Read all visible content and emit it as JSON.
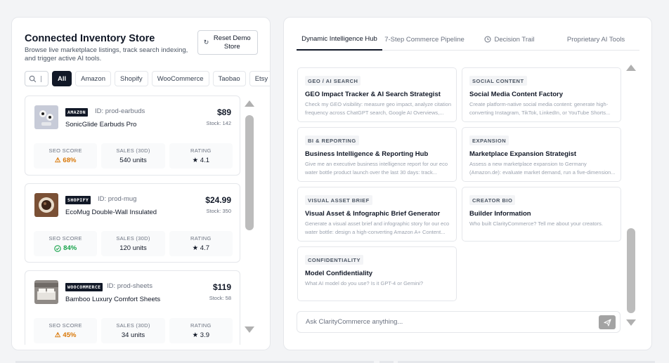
{
  "inventory": {
    "title": "Connected Inventory Store",
    "subtitle": "Browse live marketplace listings, track search indexing, and trigger active AI tools.",
    "reset_button": "Reset Demo Store",
    "reset_icon": "refresh-icon",
    "filters": [
      "All",
      "Amazon",
      "Shopify",
      "WooCommerce",
      "Taobao",
      "Etsy"
    ],
    "active_filter": "All",
    "metric_labels": {
      "seo": "SEO SCORE",
      "sales": "SALES (30D)",
      "rating": "RATING"
    },
    "products": [
      {
        "badge": "AMAZON",
        "id": "ID: prod-earbuds",
        "name": "SonicGlide Earbuds Pro",
        "price": "$89",
        "stock": "Stock: 142",
        "seo": "68%",
        "seo_status": "warning",
        "sales": "540 units",
        "rating": "★ 4.1"
      },
      {
        "badge": "SHOPIFY",
        "id": "ID: prod-mug",
        "name": "EcoMug Double-Wall Insulated",
        "price": "$24.99",
        "stock": "Stock: 350",
        "seo": "84%",
        "seo_status": "good",
        "sales": "120 units",
        "rating": "★ 4.7"
      },
      {
        "badge": "WOOCOMMERCE",
        "id": "ID: prod-sheets",
        "name": "Bamboo Luxury Comfort Sheets",
        "price": "$119",
        "stock": "Stock: 58",
        "seo": "45%",
        "seo_status": "warning",
        "sales": "34 units",
        "rating": "★ 3.9"
      }
    ]
  },
  "hub": {
    "tabs": [
      {
        "label": "Dynamic Intelligence Hub",
        "active": true
      },
      {
        "label": "7-Step Commerce Pipeline",
        "active": false
      },
      {
        "label": "Decision Trail",
        "active": false,
        "icon": "history-icon"
      },
      {
        "label": "Proprietary AI Tools",
        "active": false
      }
    ],
    "tools": [
      {
        "tag": "GEO / AI SEARCH",
        "title": "GEO Impact Tracker & AI Search Strategist",
        "desc": "Check my GEO visibility: measure geo impact, analyze citation frequency across ChatGPT search, Google AI Overviews,..."
      },
      {
        "tag": "SOCIAL CONTENT",
        "title": "Social Media Content Factory",
        "desc": "Create platform-native social media content: generate high-converting Instagram, TikTok, LinkedIn, or YouTube Shorts..."
      },
      {
        "tag": "BI & REPORTING",
        "title": "Business Intelligence & Reporting Hub",
        "desc": "Give me an executive business intelligence report for our eco water bottle product launch over the last 30 days: track..."
      },
      {
        "tag": "EXPANSION",
        "title": "Marketplace Expansion Strategist",
        "desc": "Assess a new marketplace expansion to Germany (Amazon.de): evaluate market demand, run a five-dimension..."
      },
      {
        "tag": "VISUAL ASSET BRIEF",
        "title": "Visual Asset & Infographic Brief Generator",
        "desc": "Generate a visual asset brief and infographic story for our eco water bottle: design a high-converting Amazon A+ Content..."
      },
      {
        "tag": "CREATOR BIO",
        "title": "Builder Information",
        "desc": "Who built ClarityCommerce? Tell me about your creators."
      },
      {
        "tag": "CONFIDENTIALITY",
        "title": "Model Confidentiality",
        "desc": "What AI model do you use? Is it GPT-4 or Gemini?"
      }
    ],
    "ask_placeholder": "Ask ClarityCommerce anything...",
    "send_icon": "send-icon"
  },
  "colors": {
    "accent": "#111827",
    "warning": "#d97706",
    "good": "#16a34a",
    "scrollbar": "#bcbcbc"
  }
}
